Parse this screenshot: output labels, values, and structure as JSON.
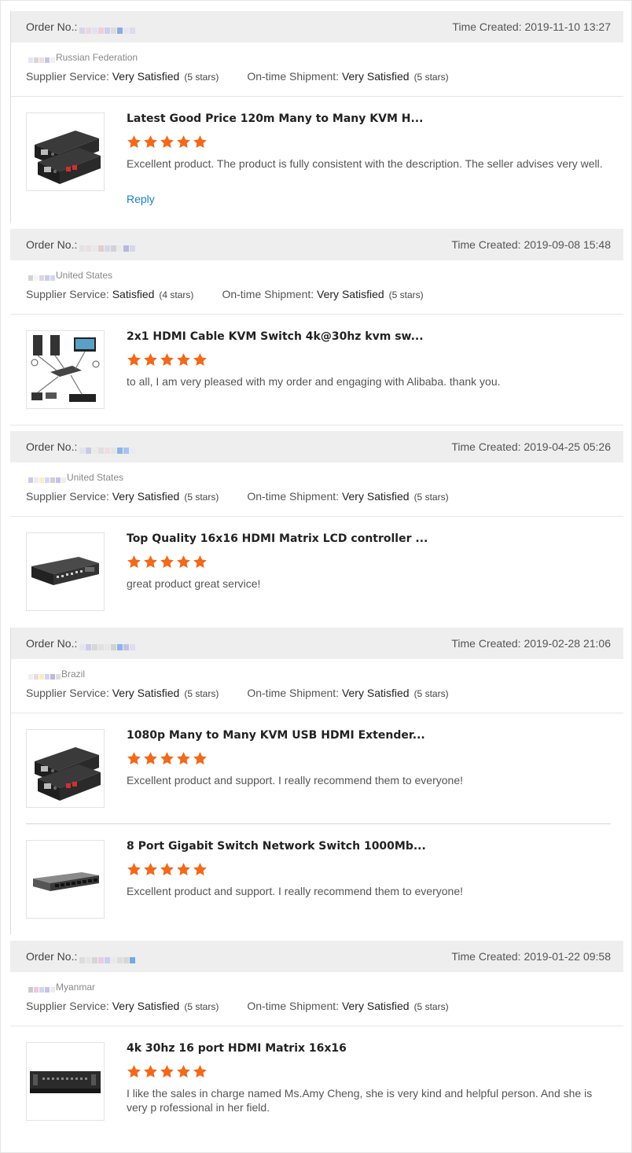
{
  "labels": {
    "order_no": "Order No.:",
    "time_created": "Time Created:",
    "supplier_service": "Supplier Service:",
    "ontime_shipment": "On-time Shipment:",
    "reply": "Reply"
  },
  "colors": {
    "star": "#f2691b",
    "link": "#1a7fd1",
    "header_bg": "#eeeeee"
  },
  "reviews": [
    {
      "time": "2019-11-10 13:27",
      "buyer_country": "Russian Federation",
      "supplier_service": "Very Satisfied",
      "supplier_stars": "(5 stars)",
      "shipment": "Very Satisfied",
      "shipment_stars": "(5 stars)",
      "items": [
        {
          "name": "Latest Good Price 120m Many to Many KVM H...",
          "rating": 5,
          "comment": "Excellent product. The product is fully consistent with the description. The seller advises very well.",
          "image": "kvm-extender-icon"
        }
      ]
    },
    {
      "time": "2019-09-08 15:48",
      "buyer_country": "United States",
      "supplier_service": "Satisfied",
      "supplier_stars": "(4 stars)",
      "shipment": "Very Satisfied",
      "shipment_stars": "(5 stars)",
      "items": [
        {
          "name": "2x1 HDMI Cable KVM Switch 4k@30hz kvm sw...",
          "rating": 5,
          "comment": "to all, I am very pleased with my order and engaging with Alibaba. thank you.",
          "image": "kvm-switch-diagram-icon"
        }
      ]
    },
    {
      "time": "2019-04-25 05:26",
      "buyer_country": "United States",
      "supplier_service": "Very Satisfied",
      "supplier_stars": "(5 stars)",
      "shipment": "Very Satisfied",
      "shipment_stars": "(5 stars)",
      "items": [
        {
          "name": "Top Quality 16x16 HDMI Matrix LCD controller ...",
          "rating": 5,
          "comment": "great product great service!",
          "image": "hdmi-matrix-icon"
        }
      ]
    },
    {
      "time": "2019-02-28 21:06",
      "buyer_country": "Brazil",
      "supplier_service": "Very Satisfied",
      "supplier_stars": "(5 stars)",
      "shipment": "Very Satisfied",
      "shipment_stars": "(5 stars)",
      "items": [
        {
          "name": "1080p Many to Many KVM USB HDMI Extender...",
          "rating": 5,
          "comment": "Excellent product and support. I really recommend them to everyone!",
          "image": "kvm-extender-icon"
        },
        {
          "name": "8 Port Gigabit Switch Network Switch 1000Mb...",
          "rating": 5,
          "comment": "Excellent product and support. I really recommend them to everyone!",
          "image": "network-switch-icon"
        }
      ]
    },
    {
      "time": "2019-01-22 09:58",
      "buyer_country": "Myanmar",
      "supplier_service": "Very Satisfied",
      "supplier_stars": "(5 stars)",
      "shipment": "Very Satisfied",
      "shipment_stars": "(5 stars)",
      "items": [
        {
          "name": "4k 30hz 16 port HDMI Matrix 16x16",
          "rating": 5,
          "comment": "I like the sales in charge named Ms.Amy Cheng, she is very kind and helpful person. And she is very p rofessional in her field.",
          "image": "rack-matrix-icon"
        }
      ]
    }
  ]
}
